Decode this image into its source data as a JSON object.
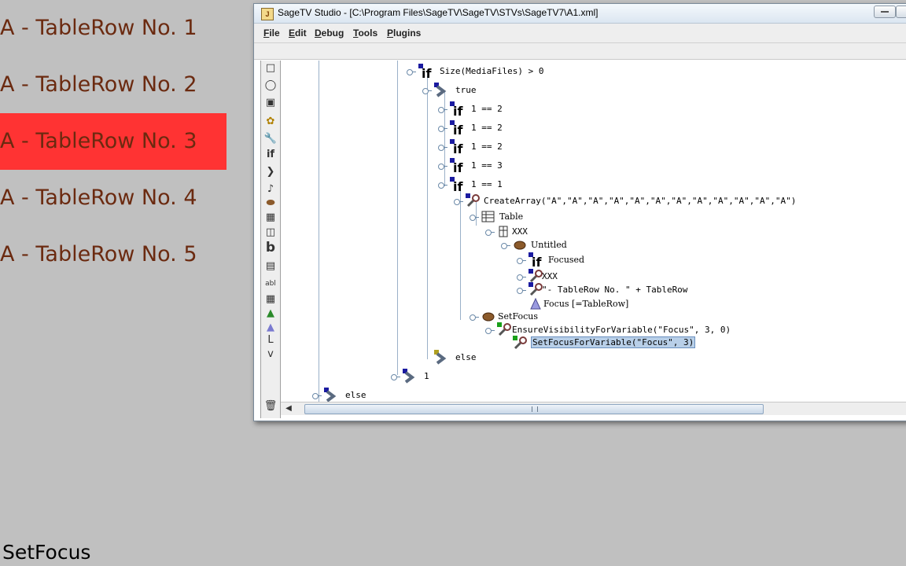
{
  "rows": [
    {
      "label": "A  - TableRow No. 1",
      "focused": false
    },
    {
      "label": "A  - TableRow No. 2",
      "focused": false
    },
    {
      "label": "A  - TableRow No. 3",
      "focused": true
    },
    {
      "label": "A  - TableRow No. 4",
      "focused": false
    },
    {
      "label": "A  - TableRow No. 5",
      "focused": false
    }
  ],
  "status_label": "SetFocus",
  "window": {
    "title": "SageTV Studio - [C:\\Program Files\\SageTV\\SageTV\\STVs\\SageTV7\\A1.xml]",
    "menu": [
      "File",
      "Edit",
      "Debug",
      "Tools",
      "Plugins"
    ]
  },
  "tree": {
    "n_size": "Size(MediaFiles) > 0",
    "n_true": "true",
    "n_c1": "1 == 2",
    "n_c2": "1 == 2",
    "n_c3": "1 == 2",
    "n_c4": "1 == 3",
    "n_c5": "1 == 1",
    "n_create": "CreateArray(\"A\",\"A\",\"A\",\"A\",\"A\",\"A\",\"A\",\"A\",\"A\",\"A\",\"A\",\"A\")",
    "n_table": "Table",
    "n_xxx": "XXX",
    "n_untitled": "Untitled",
    "n_focused": "Focused",
    "n_xxx2": "XXX",
    "n_rowtext": "\"- TableRow No. \" + TableRow",
    "n_focus": "Focus [=TableRow]",
    "n_setfocus": "SetFocus",
    "n_ensure": "EnsureVisibilityForVariable(\"Focus\", 3, 0)",
    "n_setfocusvar": "SetFocusForVariable(\"Focus\", 3)",
    "n_else1": "else",
    "n_one": "1",
    "n_else2": "else"
  },
  "colors": {
    "focused_row": "#ff3333",
    "row_text": "#6b2a10",
    "background": "#c0c0c0"
  }
}
